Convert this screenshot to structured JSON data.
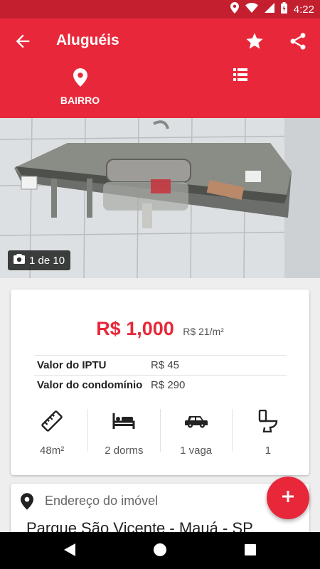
{
  "status_bar": {
    "time": "4:22",
    "icons": [
      "location-icon",
      "wifi-icon",
      "signal-icon",
      "battery-icon"
    ]
  },
  "toolbar": {
    "title": "Aluguéis",
    "back_icon": "arrow-back-icon",
    "favorite_icon": "star-icon",
    "share_icon": "share-icon"
  },
  "tabs": [
    {
      "label": "BAIRRO",
      "icon": "map-pin-icon"
    },
    {
      "label": "",
      "icon": "list-icon"
    }
  ],
  "gallery": {
    "counter": "1 de 10",
    "icon": "camera-icon"
  },
  "listing": {
    "price": "R$ 1,000",
    "price_per_sqm": "R$ 21/m²",
    "details": [
      {
        "label": "Valor do IPTU",
        "value": "R$ 45"
      },
      {
        "label": "Valor do condomínio",
        "value": "R$ 290"
      }
    ],
    "features": [
      {
        "icon": "ruler-icon",
        "value": "48m²"
      },
      {
        "icon": "bed-icon",
        "value": "2 dorms"
      },
      {
        "icon": "car-icon",
        "value": "1 vaga"
      },
      {
        "icon": "toilet-icon",
        "value": "1"
      }
    ]
  },
  "address": {
    "label": "Endereço do imóvel",
    "value": "Parque São Vicente - Mauá - SP"
  },
  "fab": {
    "icon": "plus-icon"
  },
  "colors": {
    "primary": "#e8283a",
    "status_bar": "#c31f2f",
    "price": "#e8283a"
  }
}
